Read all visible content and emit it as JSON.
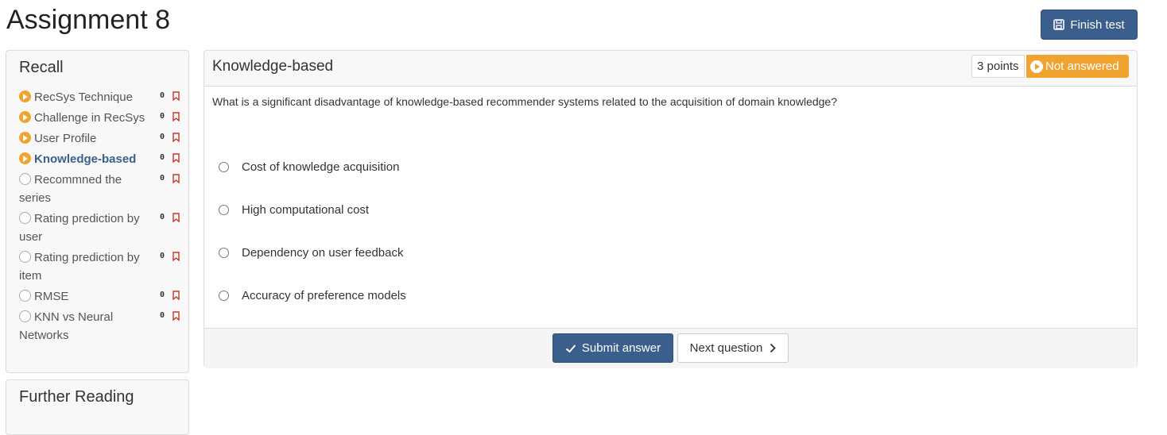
{
  "page": {
    "title": "Assignment 8"
  },
  "toolbar": {
    "finish_label": "Finish test"
  },
  "sidebar": {
    "recall_heading": "Recall",
    "further_heading": "Further Reading",
    "items": [
      {
        "label": "RecSys Technique",
        "count": "0",
        "status": "started"
      },
      {
        "label": "Challenge in RecSys",
        "count": "0",
        "status": "started"
      },
      {
        "label": "User Profile",
        "count": "0",
        "status": "started"
      },
      {
        "label": "Knowledge-based",
        "count": "0",
        "status": "started-active"
      },
      {
        "label": "Recommned the series",
        "count": "0",
        "status": "empty"
      },
      {
        "label": "Rating prediction by user",
        "count": "0",
        "status": "empty"
      },
      {
        "label": "Rating prediction by item",
        "count": "0",
        "status": "empty"
      },
      {
        "label": "RMSE",
        "count": "0",
        "status": "empty"
      },
      {
        "label": "KNN vs Neural Networks",
        "count": "0",
        "status": "empty"
      }
    ]
  },
  "question": {
    "title": "Knowledge-based",
    "points": "3 points",
    "status": "Not answered",
    "text": "What is a significant disadvantage of knowledge-based recommender systems related to the acquisition of domain knowledge?",
    "options": [
      "Cost of knowledge acquisition",
      "High computational cost",
      "Dependency on user feedback",
      "Accuracy of preference models"
    ]
  },
  "footer": {
    "submit_label": "Submit answer",
    "next_label": "Next question"
  },
  "colors": {
    "primary": "#3a5f8c",
    "warning": "#f0a32e",
    "bookmark": "#c0392b"
  }
}
